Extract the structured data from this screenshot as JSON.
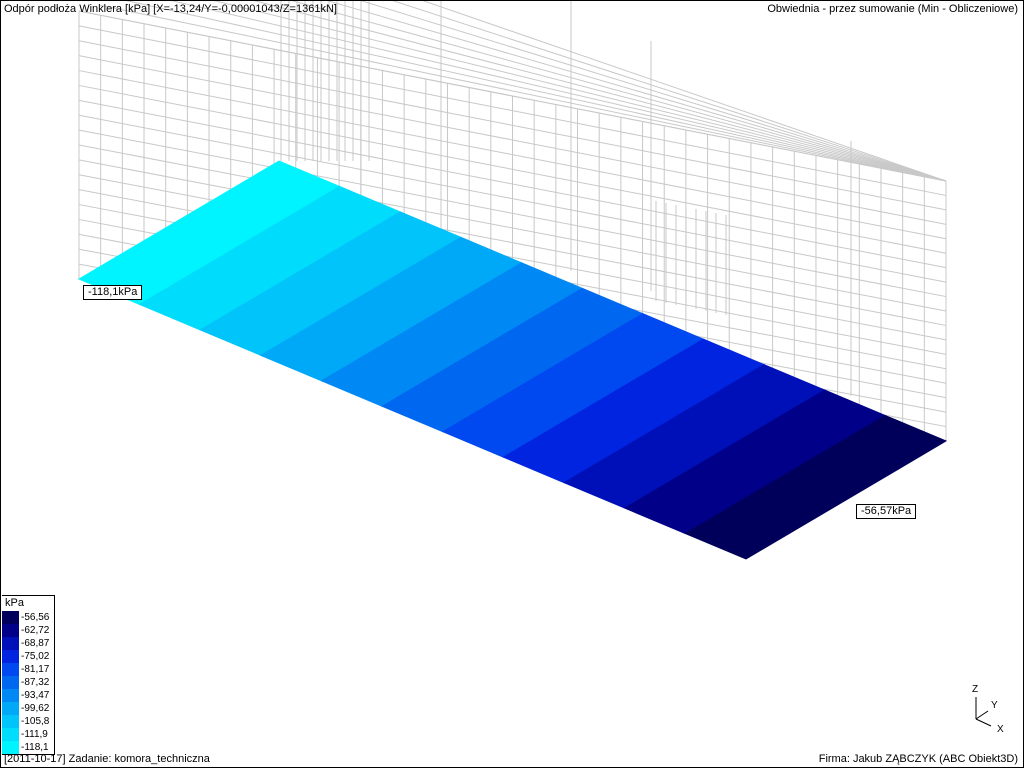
{
  "header": {
    "title": "Odpór podłoża Winklera [kPa] [X=-13,24/Y=-0,00001043/Z=1361kN]",
    "combination": "Obwiednia - przez sumowanie (Min - Obliczeniowe)"
  },
  "callouts": {
    "max_value": "-118,1kPa",
    "min_value": "-56,57kPa"
  },
  "legend": {
    "unit": "kPa",
    "entries": [
      {
        "value": "-56,56",
        "color": "#00005a"
      },
      {
        "value": "-62,72",
        "color": "#000088"
      },
      {
        "value": "-68,87",
        "color": "#0010b8"
      },
      {
        "value": "-75,02",
        "color": "#0024e0"
      },
      {
        "value": "-81,17",
        "color": "#0048f0"
      },
      {
        "value": "-87,32",
        "color": "#0068f0"
      },
      {
        "value": "-93,47",
        "color": "#0088f4"
      },
      {
        "value": "-99,62",
        "color": "#00a8f8"
      },
      {
        "value": "-105,8",
        "color": "#00c4fa"
      },
      {
        "value": "-111,9",
        "color": "#00dcfc"
      },
      {
        "value": "-118,1",
        "color": "#00f4ff"
      }
    ]
  },
  "footer": {
    "task": "[2011-10-17] Zadanie: komora_techniczna",
    "firm": "Firma: Jakub ZĄBCZYK (ABC Obiekt3D)"
  },
  "axes": {
    "z": "Z",
    "y": "Y",
    "x": "X"
  }
}
